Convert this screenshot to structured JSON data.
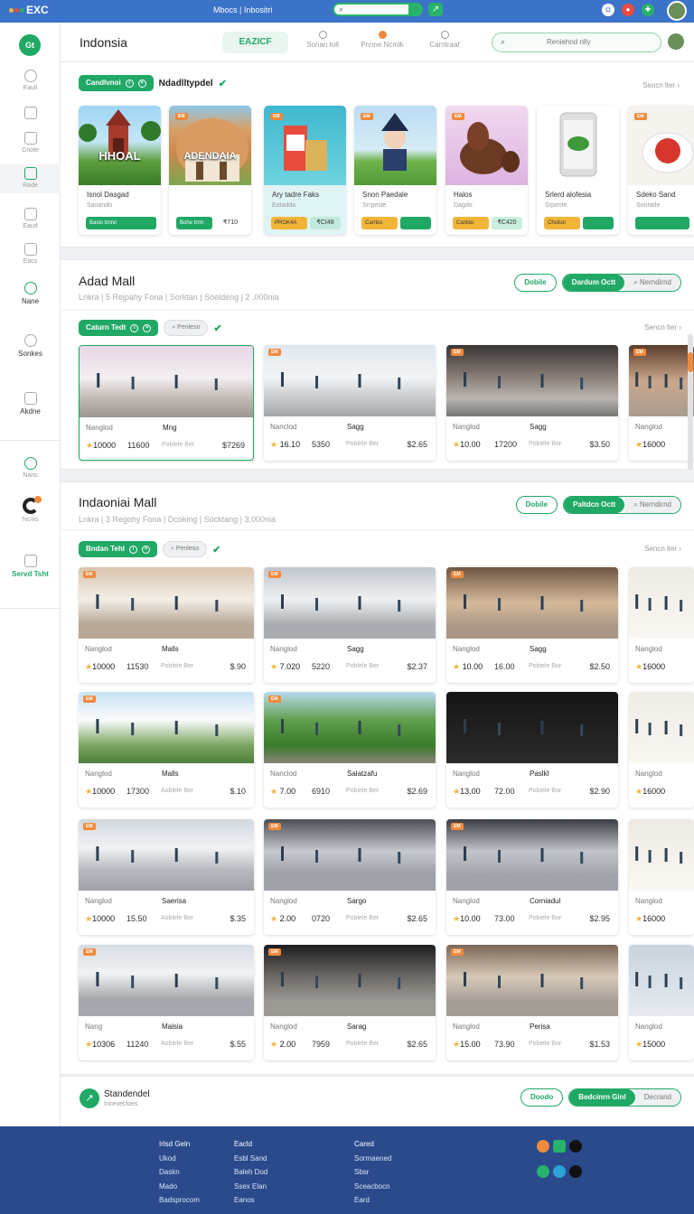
{
  "topbar": {
    "logo_text": "EXC",
    "center_text": "Mbocs | Inbositri",
    "search_value": "·",
    "arrow_icon": "arrow-icon"
  },
  "sidebar": {
    "logo": "Gt",
    "items": [
      {
        "label": "Eauli"
      },
      {
        "label": ""
      },
      {
        "label": "Cnote"
      },
      {
        "label": "Rade"
      },
      {
        "label": "Eaud"
      },
      {
        "label": "Eacs"
      },
      {
        "label": "Nane"
      },
      {
        "label": "Sonkes"
      },
      {
        "label": "Akdne"
      },
      {
        "label": "Nans"
      },
      {
        "label": "Ncnis"
      },
      {
        "label": "Servd Tsht"
      }
    ]
  },
  "header": {
    "title": "Indonsia",
    "active_tab": "EAZICF",
    "tabs": [
      "Sonan toll",
      "Prcme Ncmlk",
      "Carntraaf"
    ],
    "search_placeholder": "Reniehnd nlly"
  },
  "section1": {
    "chip_label": "Candlvnoi",
    "chip_title": "Ndadlltypdel",
    "see_more": "Sencn lter",
    "cards": [
      {
        "name": "Isnol Dasgad",
        "sub": "Saoando",
        "btn1": "Baslo trnnn",
        "btn2": "",
        "overlay": "HHOAL",
        "badge": ""
      },
      {
        "name": "",
        "sub": "",
        "btn1": "Bohe trrm",
        "btn2": "₹710",
        "overlay": "ADENDAIA",
        "badge": "EM"
      },
      {
        "name": "Ary tadre Faks",
        "sub": "Eatadda",
        "btn1": "PROK4A",
        "btn2": "₹CI48",
        "overlay": "",
        "badge": "EM"
      },
      {
        "name": "Snon Paedale",
        "sub": "Srrpeste",
        "btn1": "Carrlos",
        "btn2": "",
        "overlay": "",
        "badge": "EM"
      },
      {
        "name": "Halos",
        "sub": "Dagdo",
        "btn1": "Canldo",
        "btn2": "₹C420",
        "overlay": "",
        "badge": "EM"
      },
      {
        "name": "Srlerd alofesia",
        "sub": "Srpente",
        "btn1": "Chsliun",
        "btn2": "",
        "overlay": "",
        "badge": ""
      },
      {
        "name": "Sdeko Sand",
        "sub": "Sonrade",
        "btn1": "",
        "btn2": "",
        "overlay": "",
        "badge": "EM"
      }
    ]
  },
  "section2": {
    "title": "Adad Mall",
    "meta": "Lnkra | 5 Rejpahy Fona | Sorktan | Soeldeng | 2 ,000nia",
    "chip_label": "Caturn Tedt",
    "chip_search": "Penleso",
    "see_more": "Sencn lter",
    "toggle_outline": "Dobile",
    "toggle_on": "Dardum Octt",
    "toggle_off": "Nerndirnd",
    "cards": [
      {
        "name": "Nanglod",
        "title": "Mng",
        "rating": "★10000",
        "price": "11600",
        "label": "Poblele Ber",
        "total": "$7269"
      },
      {
        "name": "Nanclod",
        "title": "Sagg",
        "rating": "★ 16.10",
        "price": "5350",
        "label": "Poblele Ber",
        "total": "$2.65"
      },
      {
        "name": "Nanglod",
        "title": "Sagg",
        "rating": "★10.00",
        "price": "17200",
        "label": "Pobiele Bor",
        "total": "$3.50"
      },
      {
        "name": "Nanglod",
        "title": "",
        "rating": "★16000",
        "price": "",
        "label": "",
        "total": ""
      }
    ]
  },
  "section3": {
    "title": "Indaoniai Mall",
    "meta": "Lnkra | 3 Regohy Fona | Dcoking | Socktang | 3,000nia",
    "chip_label": "Bndan Tehl",
    "chip_search": "Penleso",
    "see_more": "Sencn lter",
    "toggle_outline": "Dobile",
    "toggle_on": "Paltdcn Octt",
    "toggle_off": "Nerndirnd",
    "rows": [
      [
        {
          "name": "Nanglod",
          "title": "Malls",
          "rating": "★10000",
          "price": "11530",
          "label": "Poblele Ber",
          "total": "$.90"
        },
        {
          "name": "Nanglod",
          "title": "Sagg",
          "rating": "★ 7.020",
          "price": "5220",
          "label": "Poblele Ber",
          "total": "$2.37"
        },
        {
          "name": "Nanglod",
          "title": "Sagg",
          "rating": "★ 10.00",
          "price": "16.00",
          "label": "Pobiele Bor",
          "total": "$2.50"
        },
        {
          "name": "Nanglod",
          "title": "",
          "rating": "★16000",
          "price": "",
          "label": "",
          "total": ""
        }
      ],
      [
        {
          "name": "Nanglod",
          "title": "Malls",
          "rating": "★10000",
          "price": "17300",
          "label": "Aoblele Ber",
          "total": "$.10"
        },
        {
          "name": "Nanclod",
          "title": "Salatzafu",
          "rating": "★ 7.00",
          "price": "6910",
          "label": "Pobiele Ber",
          "total": "$2.69"
        },
        {
          "name": "Nanglod",
          "title": "Paslkl",
          "rating": "★13.00",
          "price": "72.00",
          "label": "Pobiele Bor",
          "total": "$2.90"
        },
        {
          "name": "Nanglod",
          "title": "",
          "rating": "★16000",
          "price": "",
          "label": "",
          "total": ""
        }
      ],
      [
        {
          "name": "Nanglod",
          "title": "Saerisa",
          "rating": "★10000",
          "price": "15.50",
          "label": "Aoblele Ber",
          "total": "$.35"
        },
        {
          "name": "Nanglod",
          "title": "Sargo",
          "rating": "★ 2.00",
          "price": "0720",
          "label": "Poblele Ber",
          "total": "$2.65"
        },
        {
          "name": "Nanglod",
          "title": "Corniadul",
          "rating": "★10.00",
          "price": "73.00",
          "label": "Pobiele Bor",
          "total": "$2.95"
        },
        {
          "name": "Nanglod",
          "title": "",
          "rating": "★16000",
          "price": "",
          "label": "",
          "total": ""
        }
      ],
      [
        {
          "name": "Nang",
          "title": "Malsia",
          "rating": "★10306",
          "price": "11240",
          "label": "Aoblele Ber",
          "total": "$.55"
        },
        {
          "name": "Nanglod",
          "title": "Sarag",
          "rating": "★ 2.00",
          "price": "7959",
          "label": "Poblele Ber",
          "total": "$2.65"
        },
        {
          "name": "Nanglod",
          "title": "Perisa",
          "rating": "★15.00",
          "price": "73.90",
          "label": "Pobiele Bor",
          "total": "$1.53"
        },
        {
          "name": "Nanglod",
          "title": "",
          "rating": "★15000",
          "price": "",
          "label": "",
          "total": ""
        }
      ]
    ]
  },
  "bottombar": {
    "title": "Standendel",
    "subtitle": "Innevecloes",
    "toggle_outline": "Doodo",
    "toggle_on": "Bedcinrn Ginl",
    "toggle_off": "Decrand"
  },
  "footer": {
    "col1": [
      "Irlsd Geln",
      "Ukod",
      "Daskn",
      "Mado",
      "Badsprocom"
    ],
    "col2": [
      "Eacld",
      "Esbl Sand",
      "Baleh Dod",
      "Ssex Elan",
      "Eanos"
    ],
    "col3": [
      "Cared",
      "Sormaened",
      "Sbsr",
      "Sceacbocn",
      "Eard"
    ]
  }
}
